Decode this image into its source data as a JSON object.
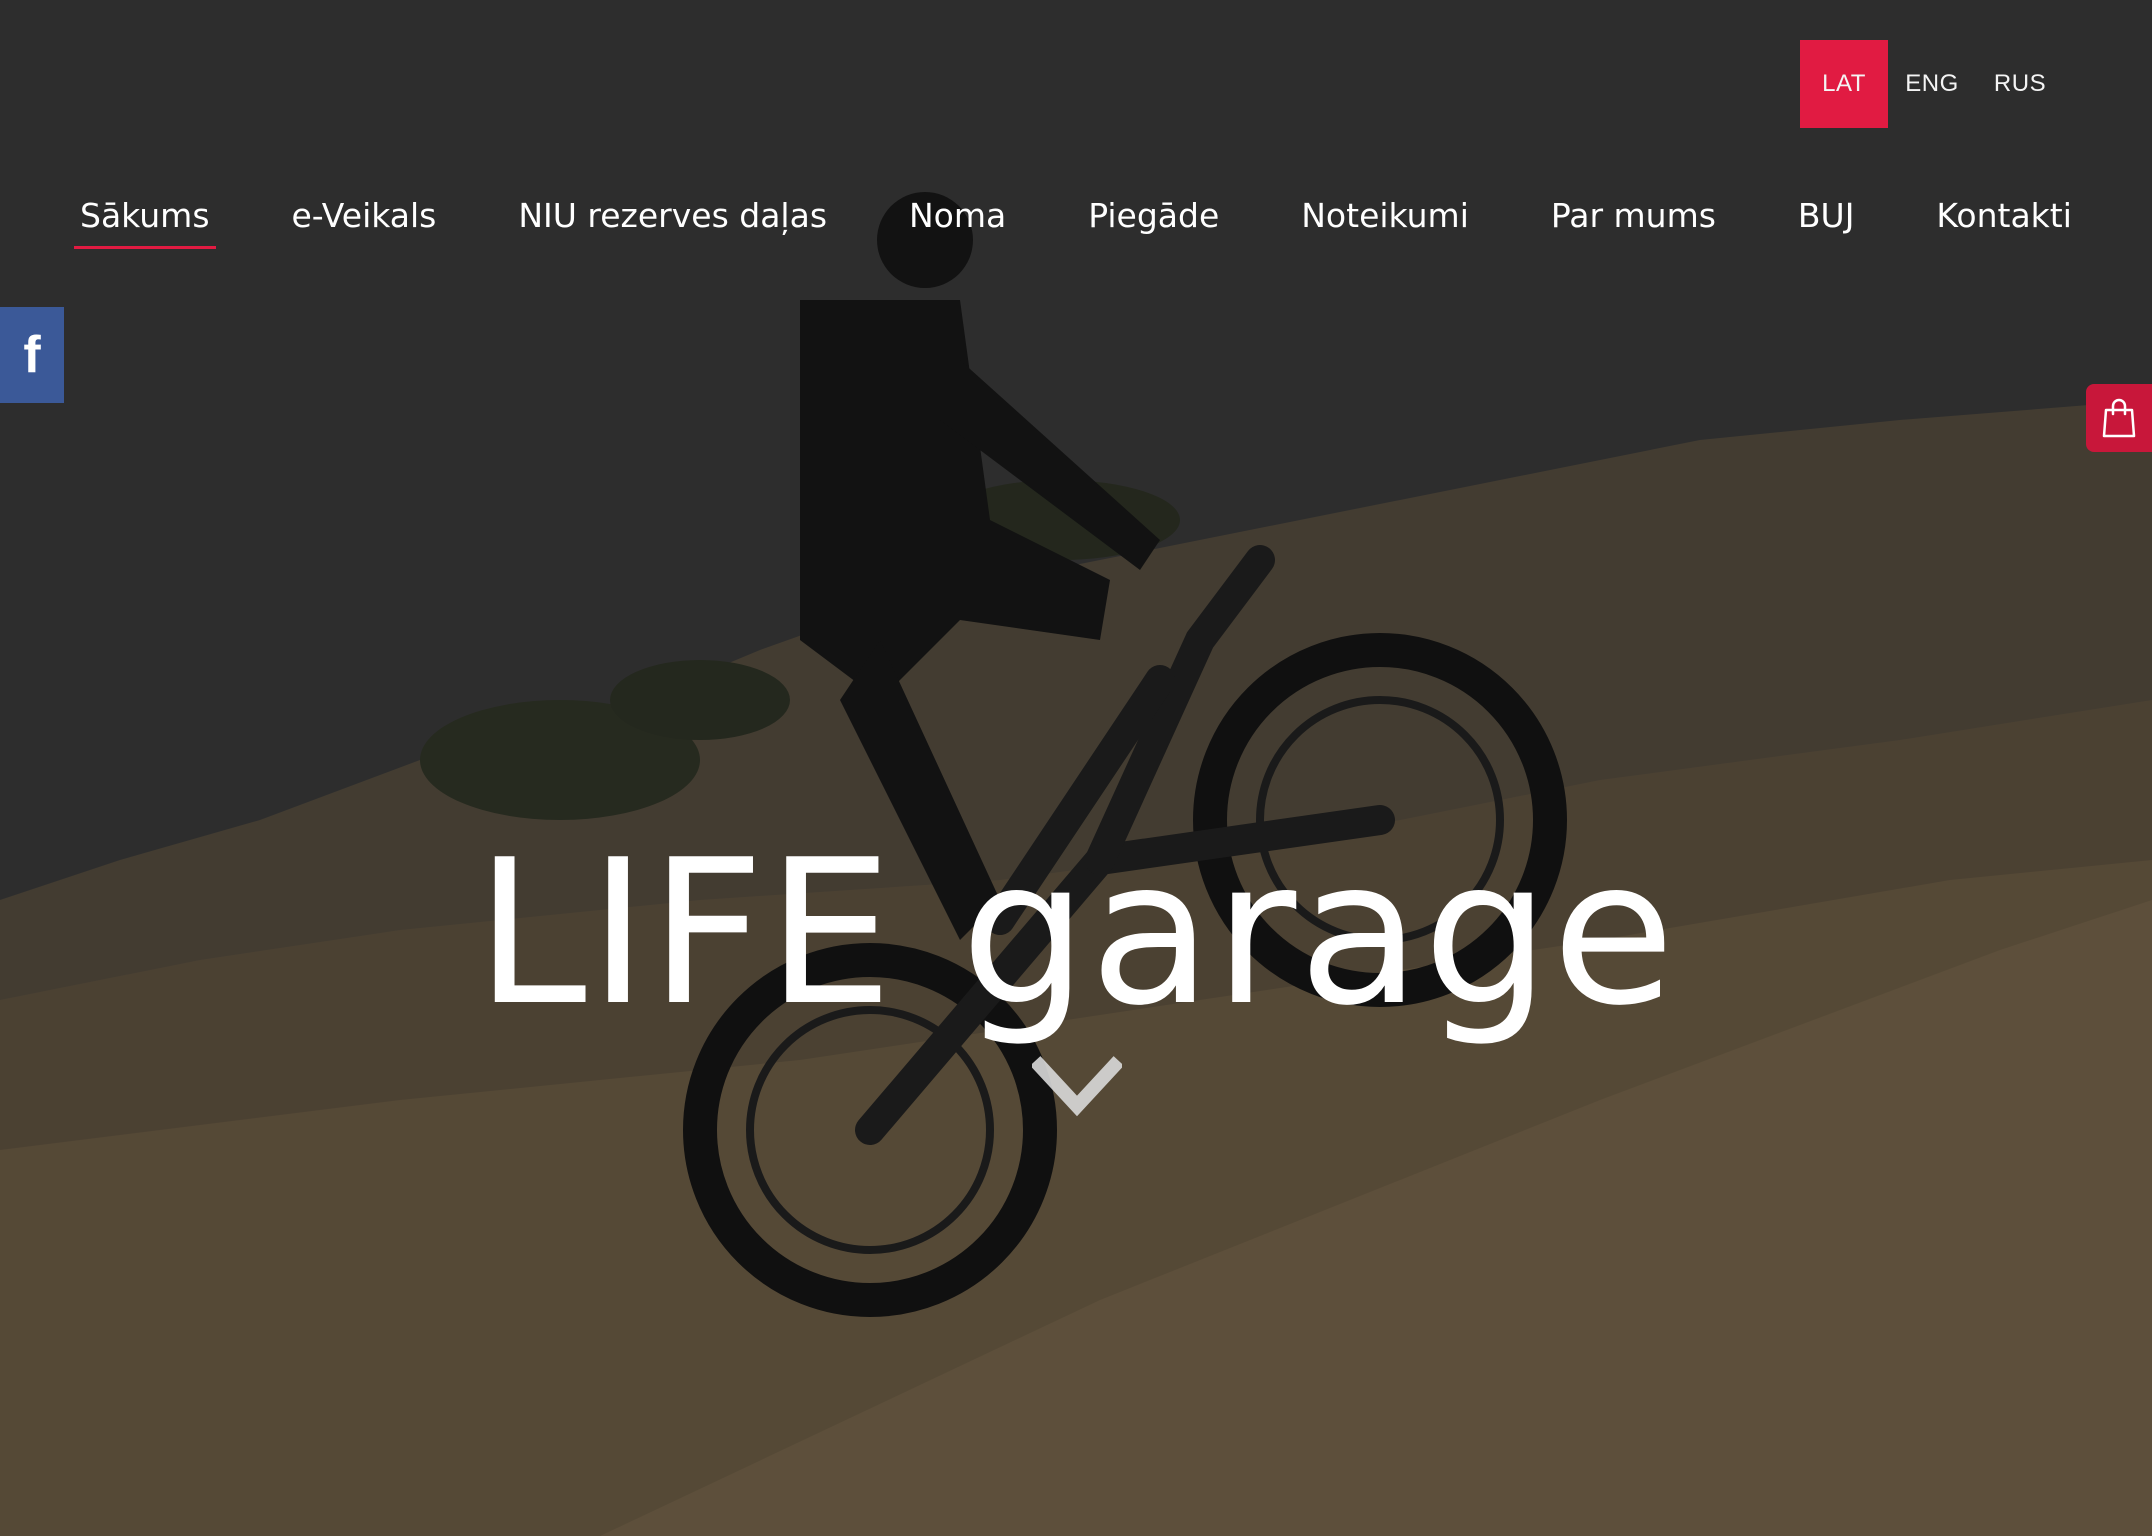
{
  "language_switcher": {
    "items": [
      {
        "label": "LAT",
        "active": true
      },
      {
        "label": "ENG",
        "active": false
      },
      {
        "label": "RUS",
        "active": false
      }
    ],
    "active_color": "#e11b42"
  },
  "nav": {
    "items": [
      {
        "label": "Sākums",
        "active": true
      },
      {
        "label": "e-Veikals",
        "active": false
      },
      {
        "label": "NIU rezerves daļas",
        "active": false
      },
      {
        "label": "Noma",
        "active": false
      },
      {
        "label": "Piegāde",
        "active": false
      },
      {
        "label": "Noteikumi",
        "active": false
      },
      {
        "label": "Par mums",
        "active": false
      },
      {
        "label": "BUJ",
        "active": false
      },
      {
        "label": "Kontakti",
        "active": false
      }
    ],
    "active_underline_color": "#e11b42"
  },
  "social": {
    "facebook": {
      "icon": "facebook-icon",
      "glyph": "f",
      "color": "#3b5998"
    }
  },
  "cart": {
    "icon": "shopping-bag-icon",
    "color": "#c8173a"
  },
  "hero": {
    "title": "LIFE garage",
    "background": "rider-on-electric-fat-bike-climbing-rock",
    "scroll_icon": "chevron-down-icon"
  }
}
